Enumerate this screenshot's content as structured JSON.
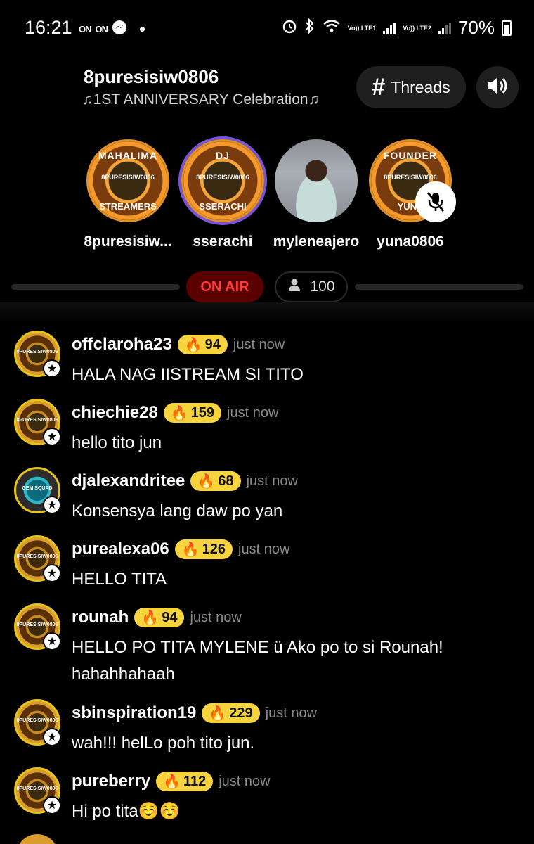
{
  "status_bar": {
    "time": "16:21",
    "left_icons": [
      "ON",
      "ON"
    ],
    "battery": "70%",
    "sim1": "Vo)) LTE1",
    "sim2": "Vo)) LTE2"
  },
  "header": {
    "title": "8puresisiw0806",
    "subtitle": "♫1ST ANNIVERSARY Celebration♫",
    "threads_label": "Threads"
  },
  "speakers": [
    {
      "name": "8puresisiw...",
      "badge_top": "MAHALIMA",
      "badge_mid": "8PURESISIW0806",
      "badge_bot": "STREAMERS"
    },
    {
      "name": "sserachi",
      "badge_top": "DJ",
      "badge_mid": "8PURESISIW0806",
      "badge_bot": "SSERACHI"
    },
    {
      "name": "myleneajero"
    },
    {
      "name": "yuna0806",
      "badge_top": "FOUNDER",
      "badge_mid": "8PURESISIW0806",
      "badge_bot": "YUNA"
    }
  ],
  "on_air_label": "ON AIR",
  "listener_count": "100",
  "messages": [
    {
      "user": "offclaroha23",
      "level": "94",
      "time": "just now",
      "text": "HALA NAG IISTREAM SI TITO"
    },
    {
      "user": "chiechie28",
      "level": "159",
      "time": "just now",
      "text": "hello tito jun"
    },
    {
      "user": "djalexandritee",
      "level": "68",
      "time": "just now",
      "text": "Konsensya lang daw po yan"
    },
    {
      "user": "purealexa06",
      "level": "126",
      "time": "just now",
      "text": "HELLO TITA"
    },
    {
      "user": "rounah",
      "level": "94",
      "time": "just now",
      "text": "HELLO PO TITA MYLENE ü Ako po to si Rounah! hahahhahaah"
    },
    {
      "user": "sbinspiration19",
      "level": "229",
      "time": "just now",
      "text": " wah!!! helLo poh tito jun."
    },
    {
      "user": "pureberry",
      "level": "112",
      "time": "just now",
      "text": "Hi po tita☺️☺️"
    }
  ],
  "colors": {
    "accent_level": "#f7d33d",
    "on_air_bg": "#5a0000",
    "on_air_text": "#ff3b3b",
    "speaker_ring": "#7b54d6"
  }
}
